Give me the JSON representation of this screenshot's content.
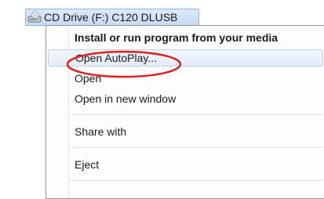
{
  "drive": {
    "icon": "cd-drive-icon",
    "label": "CD Drive (F:) C120  DLUSB"
  },
  "menu": {
    "items": [
      {
        "label": "Install or run program from your media",
        "bold": true
      },
      {
        "label": "Open AutoPlay...",
        "highlighted": true,
        "annotated": true
      },
      {
        "label": "Open"
      },
      {
        "label": "Open in new window"
      },
      {
        "label": "Share with"
      },
      {
        "label": "Eject"
      }
    ]
  },
  "annotation": {
    "shape": "ellipse",
    "color": "#e02020"
  }
}
